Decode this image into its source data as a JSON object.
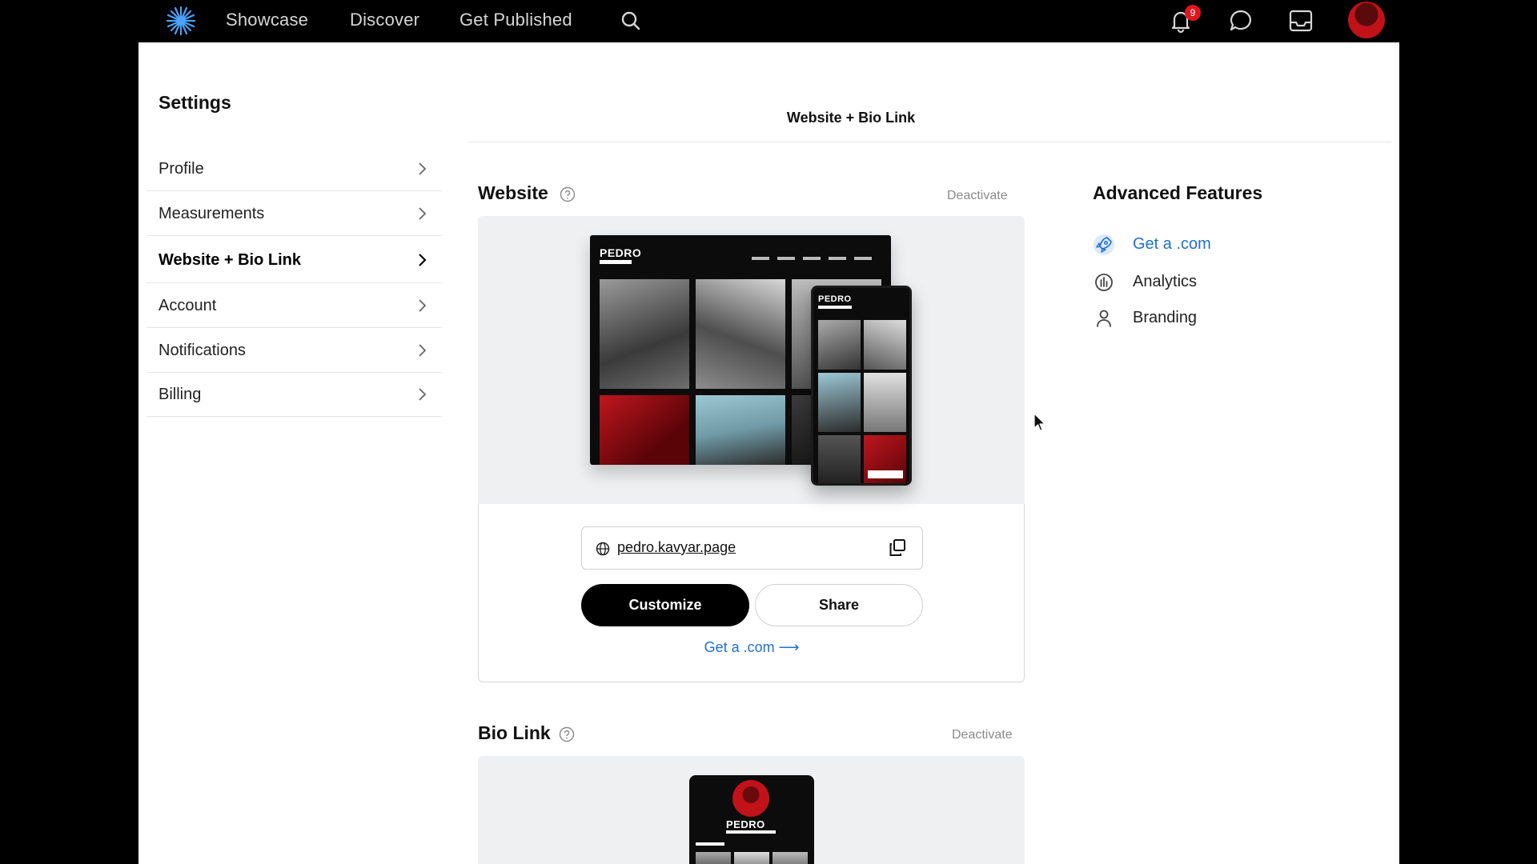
{
  "nav": {
    "links": [
      "Showcase",
      "Discover",
      "Get Published"
    ],
    "notification_count": "9"
  },
  "settings": {
    "title": "Settings",
    "items": [
      {
        "label": "Profile"
      },
      {
        "label": "Measurements"
      },
      {
        "label": "Website + Bio Link"
      },
      {
        "label": "Account"
      },
      {
        "label": "Notifications"
      },
      {
        "label": "Billing"
      }
    ]
  },
  "header": {
    "title": "Website + Bio Link"
  },
  "website": {
    "title": "Website",
    "deactivate": "Deactivate",
    "mockup_brand": "PEDRO",
    "url": "pedro.kavyar.page",
    "customize": "Customize",
    "share": "Share",
    "get_com": "Get a .com ⟶"
  },
  "bio_link": {
    "title": "Bio Link",
    "deactivate": "Deactivate",
    "mockup_brand": "PEDRO"
  },
  "advanced": {
    "title": "Advanced Features",
    "items": [
      {
        "label": "Get a .com",
        "icon": "rocket-icon"
      },
      {
        "label": "Analytics",
        "icon": "analytics-icon"
      },
      {
        "label": "Branding",
        "icon": "user-icon"
      }
    ]
  },
  "colors": {
    "accent": "#1f6fd1",
    "badge": "#e0161e",
    "preview_bg": "#eef0f2"
  }
}
